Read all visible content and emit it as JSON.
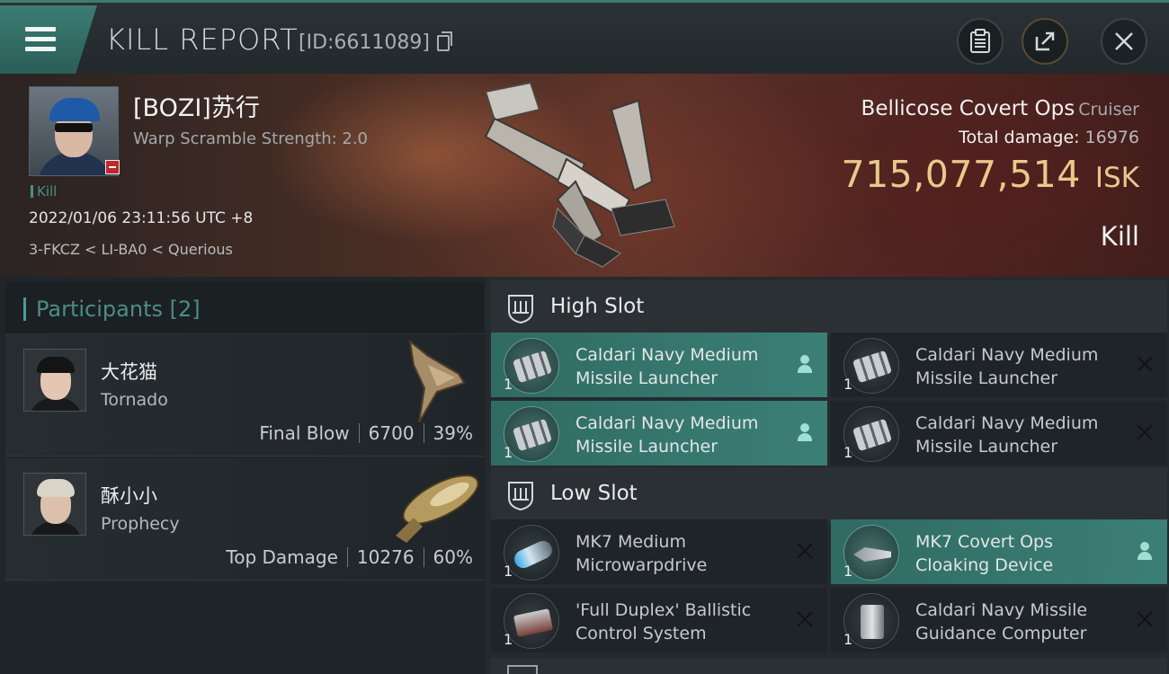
{
  "header": {
    "title": "KILL REPORT",
    "report_id": "[ID:6611089]"
  },
  "victim": {
    "pilot": "[BOZI]苏行",
    "warp_scramble": "Warp Scramble Strength: 2.0",
    "tag": "Kill",
    "timestamp": "2022/01/06 23:11:56 UTC +8",
    "location": "3-FKCZ < LI-BA0 < Querious",
    "ship_name": "Bellicose Covert Ops",
    "ship_class": "Cruiser",
    "total_damage_label": "Total damage:",
    "total_damage": "16976",
    "isk_value": "715,077,514",
    "isk_unit": "ISK",
    "result": "Kill"
  },
  "participants": {
    "title": "Participants [2]",
    "items": [
      {
        "name": "大花猫",
        "ship": "Tornado",
        "role": "Final Blow",
        "damage": "6700",
        "percent": "39%"
      },
      {
        "name": "酥小小",
        "ship": "Prophecy",
        "role": "Top Damage",
        "damage": "10276",
        "percent": "60%"
      }
    ]
  },
  "slots": {
    "high": {
      "label": "High Slot",
      "modules": [
        {
          "qty": "1",
          "line1": "Caldari Navy Medium",
          "line2": "Missile Launcher",
          "state": "person-icon",
          "icon": "missile-launcher-icon"
        },
        {
          "qty": "1",
          "line1": "Caldari Navy Medium",
          "line2": "Missile Launcher",
          "state": "close-icon",
          "icon": "missile-launcher-icon"
        },
        {
          "qty": "1",
          "line1": "Caldari Navy Medium",
          "line2": "Missile Launcher",
          "state": "person-icon",
          "icon": "missile-launcher-icon"
        },
        {
          "qty": "1",
          "line1": "Caldari Navy Medium",
          "line2": "Missile Launcher",
          "state": "close-icon",
          "icon": "missile-launcher-icon"
        }
      ]
    },
    "low": {
      "label": "Low Slot",
      "modules": [
        {
          "qty": "1",
          "line1": "MK7 Medium",
          "line2": "Microwarpdrive",
          "state": "close-icon",
          "icon": "microwarpdrive-icon"
        },
        {
          "qty": "1",
          "line1": "MK7 Covert Ops",
          "line2": "Cloaking Device",
          "state": "person-icon",
          "icon": "cloaking-device-icon"
        },
        {
          "qty": "1",
          "line1": "'Full Duplex' Ballistic",
          "line2": "Control System",
          "state": "close-icon",
          "icon": "ballistic-control-icon"
        },
        {
          "qty": "1",
          "line1": "Caldari Navy Missile",
          "line2": "Guidance Computer",
          "state": "close-icon",
          "icon": "guidance-computer-icon"
        }
      ]
    }
  },
  "colors": {
    "accent_teal": "#3b7f76",
    "isk_gold": "#e8c98a",
    "hero_red": "#5c3329"
  }
}
